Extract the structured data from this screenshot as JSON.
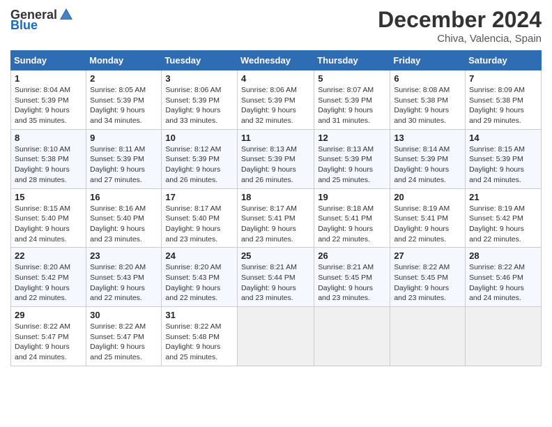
{
  "header": {
    "logo_general": "General",
    "logo_blue": "Blue",
    "main_title": "December 2024",
    "sub_title": "Chiva, Valencia, Spain"
  },
  "days_of_week": [
    "Sunday",
    "Monday",
    "Tuesday",
    "Wednesday",
    "Thursday",
    "Friday",
    "Saturday"
  ],
  "weeks": [
    [
      {
        "day": "1",
        "info": "Sunrise: 8:04 AM\nSunset: 5:39 PM\nDaylight: 9 hours\nand 35 minutes."
      },
      {
        "day": "2",
        "info": "Sunrise: 8:05 AM\nSunset: 5:39 PM\nDaylight: 9 hours\nand 34 minutes."
      },
      {
        "day": "3",
        "info": "Sunrise: 8:06 AM\nSunset: 5:39 PM\nDaylight: 9 hours\nand 33 minutes."
      },
      {
        "day": "4",
        "info": "Sunrise: 8:06 AM\nSunset: 5:39 PM\nDaylight: 9 hours\nand 32 minutes."
      },
      {
        "day": "5",
        "info": "Sunrise: 8:07 AM\nSunset: 5:39 PM\nDaylight: 9 hours\nand 31 minutes."
      },
      {
        "day": "6",
        "info": "Sunrise: 8:08 AM\nSunset: 5:38 PM\nDaylight: 9 hours\nand 30 minutes."
      },
      {
        "day": "7",
        "info": "Sunrise: 8:09 AM\nSunset: 5:38 PM\nDaylight: 9 hours\nand 29 minutes."
      }
    ],
    [
      {
        "day": "8",
        "info": "Sunrise: 8:10 AM\nSunset: 5:38 PM\nDaylight: 9 hours\nand 28 minutes."
      },
      {
        "day": "9",
        "info": "Sunrise: 8:11 AM\nSunset: 5:39 PM\nDaylight: 9 hours\nand 27 minutes."
      },
      {
        "day": "10",
        "info": "Sunrise: 8:12 AM\nSunset: 5:39 PM\nDaylight: 9 hours\nand 26 minutes."
      },
      {
        "day": "11",
        "info": "Sunrise: 8:13 AM\nSunset: 5:39 PM\nDaylight: 9 hours\nand 26 minutes."
      },
      {
        "day": "12",
        "info": "Sunrise: 8:13 AM\nSunset: 5:39 PM\nDaylight: 9 hours\nand 25 minutes."
      },
      {
        "day": "13",
        "info": "Sunrise: 8:14 AM\nSunset: 5:39 PM\nDaylight: 9 hours\nand 24 minutes."
      },
      {
        "day": "14",
        "info": "Sunrise: 8:15 AM\nSunset: 5:39 PM\nDaylight: 9 hours\nand 24 minutes."
      }
    ],
    [
      {
        "day": "15",
        "info": "Sunrise: 8:15 AM\nSunset: 5:40 PM\nDaylight: 9 hours\nand 24 minutes."
      },
      {
        "day": "16",
        "info": "Sunrise: 8:16 AM\nSunset: 5:40 PM\nDaylight: 9 hours\nand 23 minutes."
      },
      {
        "day": "17",
        "info": "Sunrise: 8:17 AM\nSunset: 5:40 PM\nDaylight: 9 hours\nand 23 minutes."
      },
      {
        "day": "18",
        "info": "Sunrise: 8:17 AM\nSunset: 5:41 PM\nDaylight: 9 hours\nand 23 minutes."
      },
      {
        "day": "19",
        "info": "Sunrise: 8:18 AM\nSunset: 5:41 PM\nDaylight: 9 hours\nand 22 minutes."
      },
      {
        "day": "20",
        "info": "Sunrise: 8:19 AM\nSunset: 5:41 PM\nDaylight: 9 hours\nand 22 minutes."
      },
      {
        "day": "21",
        "info": "Sunrise: 8:19 AM\nSunset: 5:42 PM\nDaylight: 9 hours\nand 22 minutes."
      }
    ],
    [
      {
        "day": "22",
        "info": "Sunrise: 8:20 AM\nSunset: 5:42 PM\nDaylight: 9 hours\nand 22 minutes."
      },
      {
        "day": "23",
        "info": "Sunrise: 8:20 AM\nSunset: 5:43 PM\nDaylight: 9 hours\nand 22 minutes."
      },
      {
        "day": "24",
        "info": "Sunrise: 8:20 AM\nSunset: 5:43 PM\nDaylight: 9 hours\nand 22 minutes."
      },
      {
        "day": "25",
        "info": "Sunrise: 8:21 AM\nSunset: 5:44 PM\nDaylight: 9 hours\nand 23 minutes."
      },
      {
        "day": "26",
        "info": "Sunrise: 8:21 AM\nSunset: 5:45 PM\nDaylight: 9 hours\nand 23 minutes."
      },
      {
        "day": "27",
        "info": "Sunrise: 8:22 AM\nSunset: 5:45 PM\nDaylight: 9 hours\nand 23 minutes."
      },
      {
        "day": "28",
        "info": "Sunrise: 8:22 AM\nSunset: 5:46 PM\nDaylight: 9 hours\nand 24 minutes."
      }
    ],
    [
      {
        "day": "29",
        "info": "Sunrise: 8:22 AM\nSunset: 5:47 PM\nDaylight: 9 hours\nand 24 minutes."
      },
      {
        "day": "30",
        "info": "Sunrise: 8:22 AM\nSunset: 5:47 PM\nDaylight: 9 hours\nand 25 minutes."
      },
      {
        "day": "31",
        "info": "Sunrise: 8:22 AM\nSunset: 5:48 PM\nDaylight: 9 hours\nand 25 minutes."
      },
      null,
      null,
      null,
      null
    ]
  ]
}
